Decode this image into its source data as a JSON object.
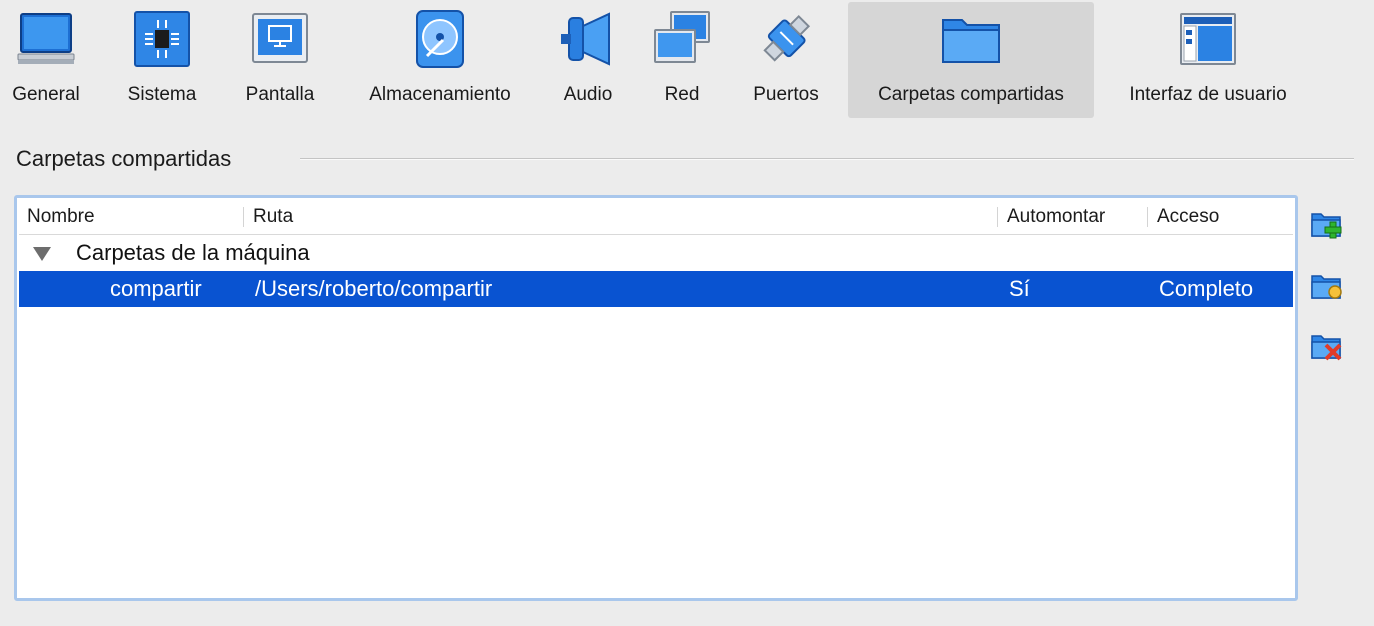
{
  "toolbar": {
    "items": [
      {
        "label": "General",
        "icon": "general-monitor-icon"
      },
      {
        "label": "Sistema",
        "icon": "system-chip-icon"
      },
      {
        "label": "Pantalla",
        "icon": "display-monitor-icon"
      },
      {
        "label": "Almacenamiento",
        "icon": "storage-disk-icon"
      },
      {
        "label": "Audio",
        "icon": "speaker-icon"
      },
      {
        "label": "Red",
        "icon": "network-icon"
      },
      {
        "label": "Puertos",
        "icon": "ports-plug-icon"
      },
      {
        "label": "Carpetas compartidas",
        "icon": "shared-folder-icon"
      },
      {
        "label": "Interfaz de usuario",
        "icon": "user-interface-icon"
      }
    ],
    "active": "Carpetas compartidas"
  },
  "section": {
    "title": "Carpetas compartidas"
  },
  "table": {
    "columns": [
      "Nombre",
      "Ruta",
      "Automontar",
      "Acceso"
    ],
    "group": {
      "label": "Carpetas de la máquina",
      "expanded": true
    },
    "rows": [
      {
        "name": "compartir",
        "path": "/Users/roberto/compartir",
        "automount": "Sí",
        "access": "Completo",
        "selected": true
      }
    ],
    "selection_color": "#0953d1"
  },
  "side_buttons": [
    {
      "icon": "add-folder-icon"
    },
    {
      "icon": "edit-folder-icon"
    },
    {
      "icon": "remove-folder-icon"
    }
  ],
  "colors": {
    "accent": "#0953d1",
    "background": "#ececec",
    "frame_border": "#a9c7ec"
  }
}
